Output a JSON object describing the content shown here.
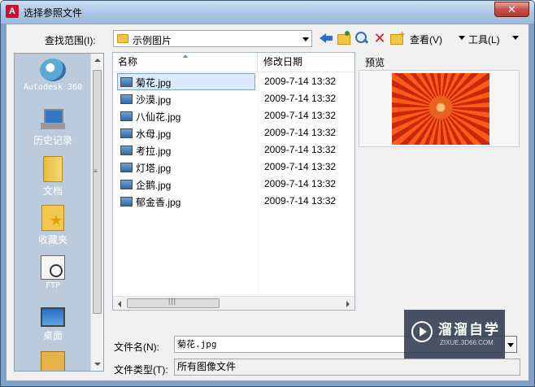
{
  "window": {
    "title": "选择参照文件",
    "close_glyph": "✕"
  },
  "toolbar": {
    "look_in_label": "查找范围(I):",
    "look_in_value": "示例图片",
    "delete_glyph": "✕",
    "views_label": "查看(V)",
    "tools_label": "工具(L)"
  },
  "places": [
    {
      "label": "Autodesk 360",
      "icon": "autodesk-360-icon"
    },
    {
      "label": "历史记录",
      "icon": "history-icon"
    },
    {
      "label": "文档",
      "icon": "documents-icon"
    },
    {
      "label": "收藏夹",
      "icon": "favorites-icon"
    },
    {
      "label": "FTP",
      "icon": "ftp-icon"
    },
    {
      "label": "桌面",
      "icon": "desktop-icon"
    }
  ],
  "file_list": {
    "columns": {
      "name": "名称",
      "date": "修改日期"
    },
    "files": [
      {
        "name": "菊花.jpg",
        "date": "2009-7-14 13:32",
        "selected": true
      },
      {
        "name": "沙漠.jpg",
        "date": "2009-7-14 13:32"
      },
      {
        "name": "八仙花.jpg",
        "date": "2009-7-14 13:32"
      },
      {
        "name": "水母.jpg",
        "date": "2009-7-14 13:32"
      },
      {
        "name": "考拉.jpg",
        "date": "2009-7-14 13:32"
      },
      {
        "name": "灯塔.jpg",
        "date": "2009-7-14 13:32"
      },
      {
        "name": "企鹅.jpg",
        "date": "2009-7-14 13:32"
      },
      {
        "name": "郁金香.jpg",
        "date": "2009-7-14 13:32"
      }
    ]
  },
  "preview": {
    "label": "预览"
  },
  "bottom": {
    "file_name_label": "文件名(N):",
    "file_name_value": "菊花.jpg",
    "file_type_label": "文件类型(T):",
    "file_type_value": "所有图像文件"
  },
  "watermark": {
    "title": "溜溜自学",
    "url": "ZIXUE.3D66.COM"
  },
  "colors": {
    "selection": "#dcebfc",
    "titlebar": "#a9c5e3",
    "places_bg": "#bccbdb"
  }
}
